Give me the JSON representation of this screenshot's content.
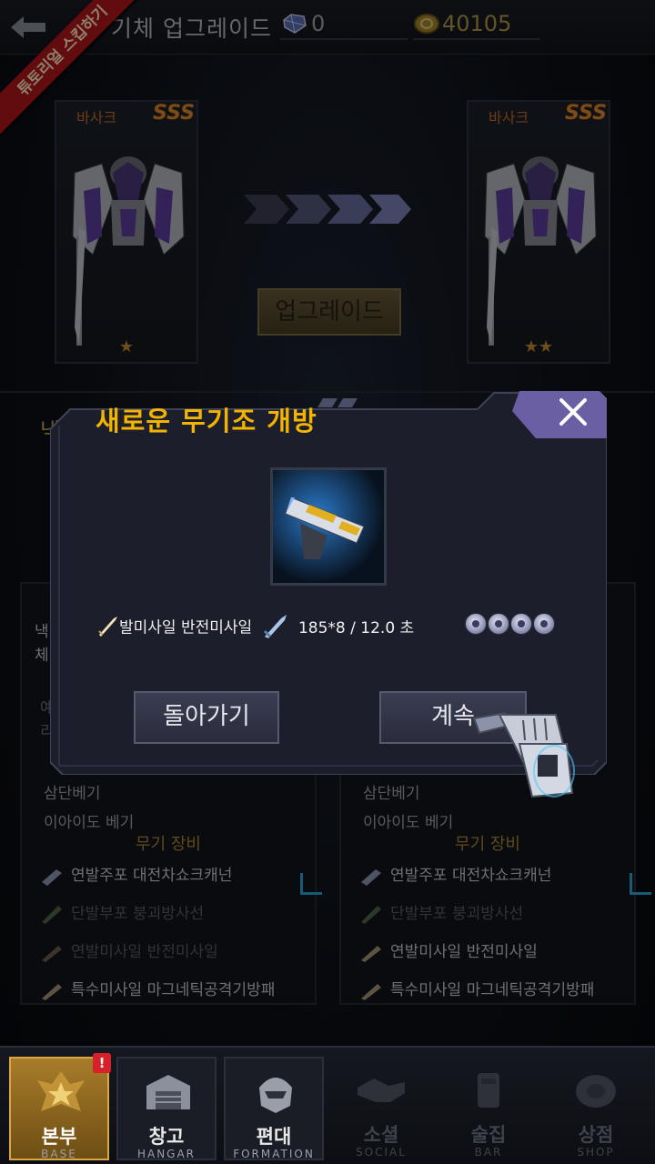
{
  "header": {
    "title": "기체 업그레이드",
    "gems": "0",
    "gold": "40105"
  },
  "tutorial_ribbon": "튜토리얼 스킵하기",
  "mech_left": {
    "name": "바사크",
    "rank": "SSS",
    "stars": "★"
  },
  "mech_right": {
    "name": "바사크",
    "rank": "SSS",
    "stars": "★★"
  },
  "upgrade_button": "업그레이드",
  "background": {
    "left_fragment_1": "낵",
    "left_fragment_2": "체",
    "left_fragment_3": "예",
    "left_fragment_4": "리",
    "left_skills": [
      "삼단베기",
      "이아이도 베기"
    ],
    "right_skills": [
      "삼단베기",
      "이아이도 베기"
    ],
    "weapon_title": "무기 장비",
    "left_weapons": [
      {
        "label": "연발주포  대전차쇼크캐넌",
        "dim": false
      },
      {
        "label": "단발부포  붕괴방사선",
        "dim": true
      },
      {
        "label": "연발미사일  반전미사일",
        "dim": true
      },
      {
        "label": "특수미사일  마그네틱공격기방패",
        "dim": false
      }
    ],
    "right_weapons": [
      {
        "label": "연발주포  대전차쇼크캐넌",
        "dim": false
      },
      {
        "label": "단발부포  붕괴방사선",
        "dim": true
      },
      {
        "label": "연발미사일  반전미사일",
        "dim": false
      },
      {
        "label": "특수미사일  마그네틱공격기방패",
        "dim": false
      }
    ]
  },
  "dialog": {
    "title": "새로운 무기조 개방",
    "weapon_text": "발미사일  반전미사일",
    "damage_text": "185*8  / 12.0 초",
    "slot_count": 4,
    "back_button": "돌아가기",
    "continue_button": "계속"
  },
  "bottom_nav": [
    {
      "label": "본부",
      "sub": "BASE",
      "state": "active",
      "badge": "!",
      "icon": "base-emblem-icon"
    },
    {
      "label": "창고",
      "sub": "HANGAR",
      "state": "normal",
      "icon": "hangar-icon"
    },
    {
      "label": "편대",
      "sub": "FORMATION",
      "state": "normal",
      "icon": "formation-helmet-icon"
    },
    {
      "label": "소셜",
      "sub": "SOCIAL",
      "state": "disabled",
      "icon": "handshake-icon"
    },
    {
      "label": "술집",
      "sub": "BAR",
      "state": "disabled",
      "icon": "bar-icon"
    },
    {
      "label": "상점",
      "sub": "SHOP",
      "state": "disabled",
      "icon": "shop-icon"
    }
  ]
}
